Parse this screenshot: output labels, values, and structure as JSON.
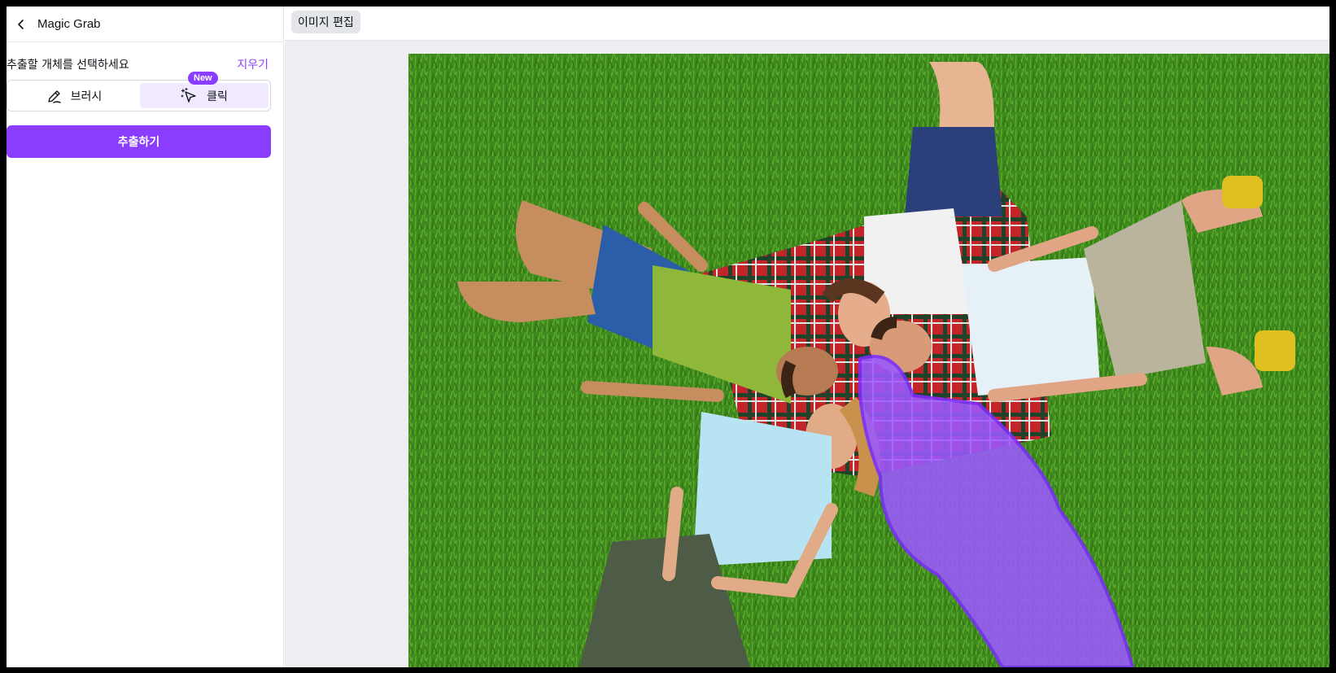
{
  "panel": {
    "title": "Magic Grab",
    "prompt": "추출할 개체를 선택하세요",
    "clear_label": "지우기",
    "modes": [
      {
        "label": "브러시",
        "icon": "brush-icon"
      },
      {
        "label": "클릭",
        "icon": "magic-cursor-icon",
        "selected": true
      }
    ],
    "new_badge": "New",
    "extract_label": "추출하기"
  },
  "toolbar": {
    "edit_label": "이미지 편집"
  },
  "colors": {
    "accent": "#8b3dff",
    "selected_bg": "#f1eaff",
    "canvas_bg": "#eceef2",
    "grass": "#3f8a1e",
    "selection_overlay": "#9b59ff"
  }
}
